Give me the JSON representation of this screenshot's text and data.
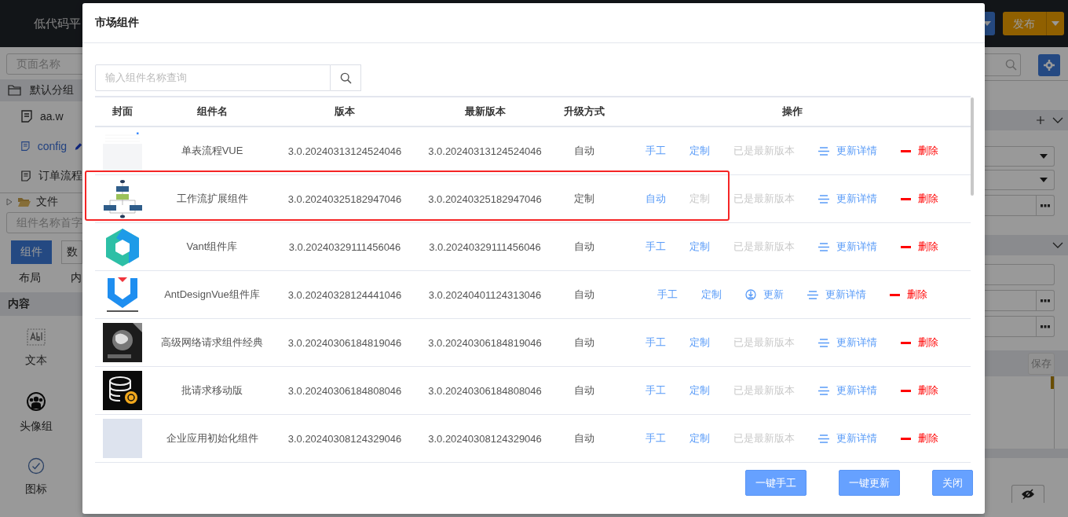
{
  "app": {
    "title": "低代码平",
    "publish_button": "发布",
    "sidebar": {
      "page_search": {
        "placeholder": "页面名称"
      },
      "tree": [
        {
          "label": "默认分组",
          "kind": "group",
          "expanded": true,
          "children": [
            {
              "label": "aa.w",
              "selected": false
            },
            {
              "label": "config",
              "selected": true
            },
            {
              "label": "订单流程",
              "selected": false
            }
          ]
        },
        {
          "label": "文件",
          "kind": "folder",
          "expanded": false
        }
      ],
      "component_search": {
        "placeholder": "组件名称首字"
      },
      "tabs": [
        {
          "label": "组件",
          "selected": true
        },
        {
          "label": "数",
          "selected": false
        }
      ],
      "subtabs": [
        "布局",
        "内"
      ],
      "section": "内容",
      "palette": [
        {
          "label": "文本",
          "kind": "text-field"
        },
        {
          "label": "头像组",
          "kind": "avatar-group"
        },
        {
          "label": "图标",
          "kind": "check-circle"
        }
      ]
    },
    "right_panel": {
      "save_button": "保存"
    }
  },
  "dialog": {
    "title": "市场组件",
    "search": {
      "placeholder": "输入组件名称查询"
    },
    "columns": [
      "封面",
      "组件名",
      "版本",
      "最新版本",
      "升级方式",
      "操作"
    ],
    "rows": [
      {
        "cover": {
          "kind": "screenshot"
        },
        "name": "单表流程VUE",
        "version": "3.0.20240313124524046",
        "latest": "3.0.20240313124524046",
        "upgrade": "自动",
        "highlighted": false,
        "actions": [
          {
            "kind": "mode",
            "label": "手工",
            "disabled": false
          },
          {
            "kind": "custom",
            "label": "定制",
            "disabled": false
          },
          {
            "kind": "update",
            "label": "已是最新版本",
            "disabled": true
          },
          {
            "kind": "details",
            "label": "更新详情",
            "disabled": false
          },
          {
            "kind": "delete",
            "label": "删除",
            "disabled": false
          }
        ]
      },
      {
        "cover": {
          "kind": "flowchart"
        },
        "name": "工作流扩展组件",
        "version": "3.0.20240325182947046",
        "latest": "3.0.20240325182947046",
        "upgrade": "定制",
        "highlighted": true,
        "actions": [
          {
            "kind": "mode",
            "label": "自动",
            "disabled": false
          },
          {
            "kind": "custom",
            "label": "定制",
            "disabled": true
          },
          {
            "kind": "update",
            "label": "已是最新版本",
            "disabled": true
          },
          {
            "kind": "details",
            "label": "更新详情",
            "disabled": false
          },
          {
            "kind": "delete",
            "label": "删除",
            "disabled": false
          }
        ]
      },
      {
        "cover": {
          "kind": "hexagon"
        },
        "name": "Vant组件库",
        "version": "3.0.20240329111456046",
        "latest": "3.0.20240329111456046",
        "upgrade": "自动",
        "highlighted": false,
        "actions": [
          {
            "kind": "mode",
            "label": "手工",
            "disabled": false
          },
          {
            "kind": "custom",
            "label": "定制",
            "disabled": false
          },
          {
            "kind": "update",
            "label": "已是最新版本",
            "disabled": true
          },
          {
            "kind": "details",
            "label": "更新详情",
            "disabled": false
          },
          {
            "kind": "delete",
            "label": "删除",
            "disabled": false
          }
        ]
      },
      {
        "cover": {
          "kind": "shield"
        },
        "name": "AntDesignVue组件库",
        "version": "3.0.20240328124441046",
        "latest": "3.0.20240401124313046",
        "upgrade": "自动",
        "highlighted": false,
        "actions": [
          {
            "kind": "mode",
            "label": "手工",
            "disabled": false
          },
          {
            "kind": "custom",
            "label": "定制",
            "disabled": false
          },
          {
            "kind": "update",
            "label": "更新",
            "disabled": false
          },
          {
            "kind": "details",
            "label": "更新详情",
            "disabled": false
          },
          {
            "kind": "delete",
            "label": "删除",
            "disabled": false
          }
        ]
      },
      {
        "cover": {
          "kind": "globe"
        },
        "name": "高级网络请求组件经典",
        "version": "3.0.20240306184819046",
        "latest": "3.0.20240306184819046",
        "upgrade": "自动",
        "highlighted": false,
        "actions": [
          {
            "kind": "mode",
            "label": "手工",
            "disabled": false
          },
          {
            "kind": "custom",
            "label": "定制",
            "disabled": false
          },
          {
            "kind": "update",
            "label": "已是最新版本",
            "disabled": true
          },
          {
            "kind": "details",
            "label": "更新详情",
            "disabled": false
          },
          {
            "kind": "delete",
            "label": "删除",
            "disabled": false
          }
        ]
      },
      {
        "cover": {
          "kind": "database"
        },
        "name": "批请求移动版",
        "version": "3.0.20240306184808046",
        "latest": "3.0.20240306184808046",
        "upgrade": "自动",
        "highlighted": false,
        "actions": [
          {
            "kind": "mode",
            "label": "手工",
            "disabled": false
          },
          {
            "kind": "custom",
            "label": "定制",
            "disabled": false
          },
          {
            "kind": "update",
            "label": "已是最新版本",
            "disabled": true
          },
          {
            "kind": "details",
            "label": "更新详情",
            "disabled": false
          },
          {
            "kind": "delete",
            "label": "删除",
            "disabled": false
          }
        ]
      },
      {
        "cover": {
          "kind": "blank"
        },
        "name": "企业应用初始化组件",
        "version": "3.0.20240308124329046",
        "latest": "3.0.20240308124329046",
        "upgrade": "自动",
        "highlighted": false,
        "actions": [
          {
            "kind": "mode",
            "label": "手工",
            "disabled": false
          },
          {
            "kind": "custom",
            "label": "定制",
            "disabled": false
          },
          {
            "kind": "update",
            "label": "已是最新版本",
            "disabled": true
          },
          {
            "kind": "details",
            "label": "更新详情",
            "disabled": false
          },
          {
            "kind": "delete",
            "label": "删除",
            "disabled": false
          }
        ]
      }
    ],
    "footer_buttons": [
      "一键手工",
      "一键更新",
      "关闭"
    ]
  }
}
